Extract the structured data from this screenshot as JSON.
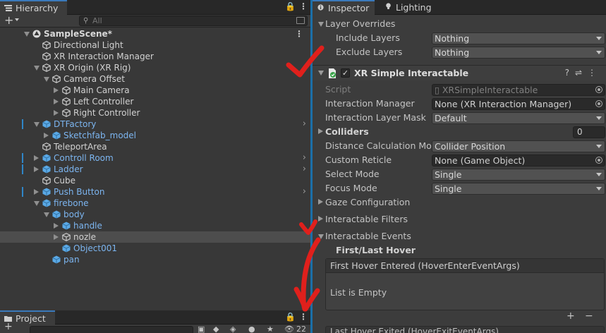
{
  "hierarchy": {
    "tab_label": "Hierarchy",
    "search_placeholder": "All",
    "rows": [
      {
        "label": "SampleScene*",
        "depth": 0,
        "fold": "open",
        "kind": "scene"
      },
      {
        "label": "Directional Light",
        "depth": 1,
        "fold": "none",
        "kind": "obj"
      },
      {
        "label": "XR Interaction Manager",
        "depth": 1,
        "fold": "none",
        "kind": "obj"
      },
      {
        "label": "XR Origin (XR Rig)",
        "depth": 1,
        "fold": "open",
        "kind": "obj"
      },
      {
        "label": "Camera Offset",
        "depth": 2,
        "fold": "open",
        "kind": "obj"
      },
      {
        "label": "Main Camera",
        "depth": 3,
        "fold": "closed",
        "kind": "obj"
      },
      {
        "label": "Left Controller",
        "depth": 3,
        "fold": "closed",
        "kind": "obj"
      },
      {
        "label": "Right Controller",
        "depth": 3,
        "fold": "closed",
        "kind": "obj"
      },
      {
        "label": "DTFactory",
        "depth": 1,
        "fold": "open",
        "kind": "prefab",
        "bar": true,
        "chevron": true
      },
      {
        "label": "Sketchfab_model",
        "depth": 2,
        "fold": "closed",
        "kind": "prefab"
      },
      {
        "label": "TeleportArea",
        "depth": 1,
        "fold": "none",
        "kind": "obj"
      },
      {
        "label": "Controll Room",
        "depth": 1,
        "fold": "closed",
        "kind": "prefab",
        "bar": true,
        "chevron": true
      },
      {
        "label": "Ladder",
        "depth": 1,
        "fold": "closed",
        "kind": "prefab",
        "bar": true,
        "chevron": true
      },
      {
        "label": "Cube",
        "depth": 1,
        "fold": "none",
        "kind": "obj"
      },
      {
        "label": "Push Button",
        "depth": 1,
        "fold": "closed",
        "kind": "prefab",
        "bar": true,
        "chevron": true
      },
      {
        "label": "firebone",
        "depth": 1,
        "fold": "open",
        "kind": "prefab"
      },
      {
        "label": "body",
        "depth": 2,
        "fold": "open",
        "kind": "prefab"
      },
      {
        "label": "handle",
        "depth": 3,
        "fold": "closed",
        "kind": "prefab"
      },
      {
        "label": "nozle",
        "depth": 3,
        "fold": "closed",
        "kind": "obj",
        "selected": true
      },
      {
        "label": "Object001",
        "depth": 3,
        "fold": "none",
        "kind": "prefab"
      },
      {
        "label": "pan",
        "depth": 2,
        "fold": "none",
        "kind": "prefab"
      }
    ]
  },
  "project": {
    "tab_label": "Project",
    "hidden_count": "22"
  },
  "inspector": {
    "tabs": {
      "inspector": "Inspector",
      "lighting": "Lighting"
    },
    "layer_overrides": {
      "label": "Layer Overrides",
      "include_label": "Include Layers",
      "include_value": "Nothing",
      "exclude_label": "Exclude Layers",
      "exclude_value": "Nothing"
    },
    "component": {
      "title": "XR Simple Interactable",
      "enabled": true,
      "enabled_mark": "✓"
    },
    "props": {
      "script_label": "Script",
      "script_value": "XRSimpleInteractable",
      "interaction_manager_label": "Interaction Manager",
      "interaction_manager_value": "None (XR Interaction Manager)",
      "layer_mask_label": "Interaction Layer Mask",
      "layer_mask_value": "Default",
      "colliders_label": "Colliders",
      "colliders_value": "0",
      "distance_label": "Distance Calculation Mode",
      "distance_value": "Collider Position",
      "reticle_label": "Custom Reticle",
      "reticle_value": "None (Game Object)",
      "select_mode_label": "Select Mode",
      "select_mode_value": "Single",
      "focus_mode_label": "Focus Mode",
      "focus_mode_value": "Single",
      "gaze_label": "Gaze Configuration",
      "filters_label": "Interactable Filters",
      "events_label": "Interactable Events",
      "first_last_hover_label": "First/Last Hover",
      "first_hover_entered": "First Hover Entered (HoverEnterEventArgs)",
      "list_empty": "List is Empty",
      "last_hover_exited": "Last Hover Exited (HoverExitEventArgs)"
    }
  },
  "colors": {
    "annotation": "#e0201c",
    "selection_bar": "#1b6fa8",
    "prefab_text": "#7cb5f0"
  }
}
